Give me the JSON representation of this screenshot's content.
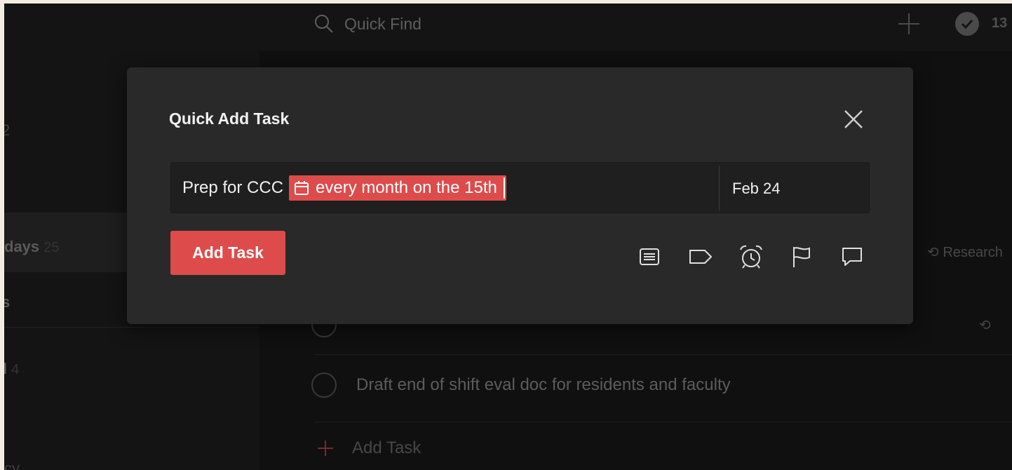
{
  "search": {
    "placeholder": "Quick Find"
  },
  "topbar": {
    "karma": "13"
  },
  "sidebar": {
    "items": [
      {
        "label": "2",
        "count": ""
      },
      {
        "label": "",
        "count": ""
      },
      {
        "label": "days",
        "count": "25"
      },
      {
        "label": "s",
        "count": ""
      },
      {
        "label": "l",
        "count": "4"
      },
      {
        "label": "cy",
        "count": ""
      }
    ]
  },
  "main": {
    "research_label": "Research",
    "tasks": [
      {
        "text": "Draft end of shift eval doc for residents and faculty"
      }
    ],
    "add_task_label": "Add Task"
  },
  "modal": {
    "title": "Quick Add Task",
    "input_text": "Prep for CCC",
    "highlight_text": "every month on the 15th",
    "due_date": "Feb 24",
    "add_button": "Add Task",
    "tools": [
      "comment-list-icon",
      "label-icon",
      "alarm-clock-icon",
      "flag-icon",
      "comment-icon"
    ]
  },
  "colors": {
    "accent": "#dd4b4b",
    "modal_bg": "#292929",
    "input_bg": "#1f1f1f"
  }
}
